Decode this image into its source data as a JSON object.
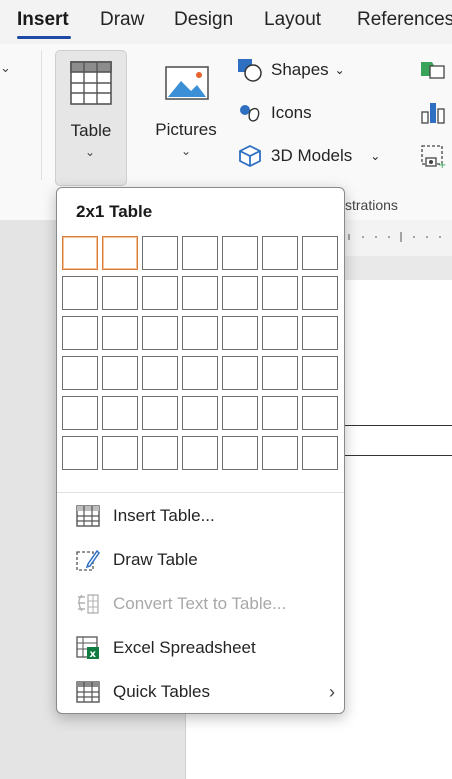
{
  "ribbon_tabs": [
    {
      "label": "Insert",
      "active": true
    },
    {
      "label": "Draw"
    },
    {
      "label": "Design"
    },
    {
      "label": "Layout"
    },
    {
      "label": "References"
    }
  ],
  "ribbon": {
    "table_label": "Table",
    "pictures_label": "Pictures",
    "shapes_label": "Shapes",
    "icons_label": "Icons",
    "models_label": "3D Models",
    "group_label": "strations"
  },
  "table_menu": {
    "title": "2x1 Table",
    "grid": {
      "columns": 7,
      "rows": 6,
      "selected_columns": 2,
      "selected_rows": 1
    },
    "items": [
      {
        "label": "Insert Table...",
        "icon": "table-grid-icon",
        "enabled": true
      },
      {
        "label": "Draw Table",
        "icon": "pencil-table-icon",
        "enabled": true
      },
      {
        "label": "Convert Text to Table...",
        "icon": "convert-text-icon",
        "enabled": false
      },
      {
        "label": "Excel Spreadsheet",
        "icon": "excel-icon",
        "enabled": true
      },
      {
        "label": "Quick Tables",
        "icon": "quick-tables-icon",
        "enabled": true,
        "submenu": true
      }
    ]
  },
  "colors": {
    "accent": "#1f4aa8",
    "highlight": "#d97d3a",
    "excel_green": "#107c41"
  }
}
